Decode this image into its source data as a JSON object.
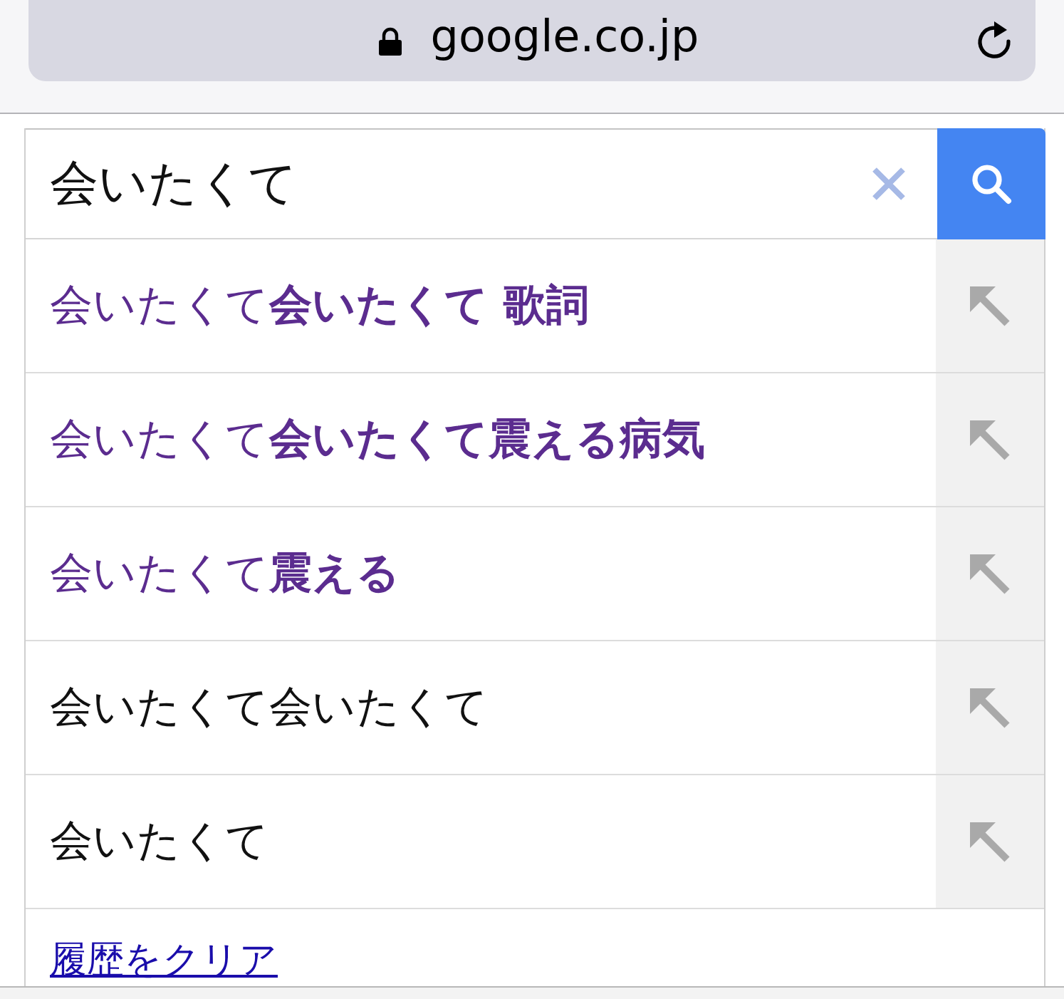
{
  "browser": {
    "url": "google.co.jp"
  },
  "search": {
    "value": "会いたくて"
  },
  "suggestions": [
    {
      "text": "会いたくて**会いたくて 歌詞**",
      "visited": true
    },
    {
      "text": "会いたくて**会いたくて震える病気**",
      "visited": true
    },
    {
      "text": "会いたくて**震える**",
      "visited": true
    },
    {
      "text": "会いたくて会いたくて",
      "visited": false
    },
    {
      "text": "会いたくて",
      "visited": false
    }
  ],
  "clear_history": "履歴をクリア"
}
